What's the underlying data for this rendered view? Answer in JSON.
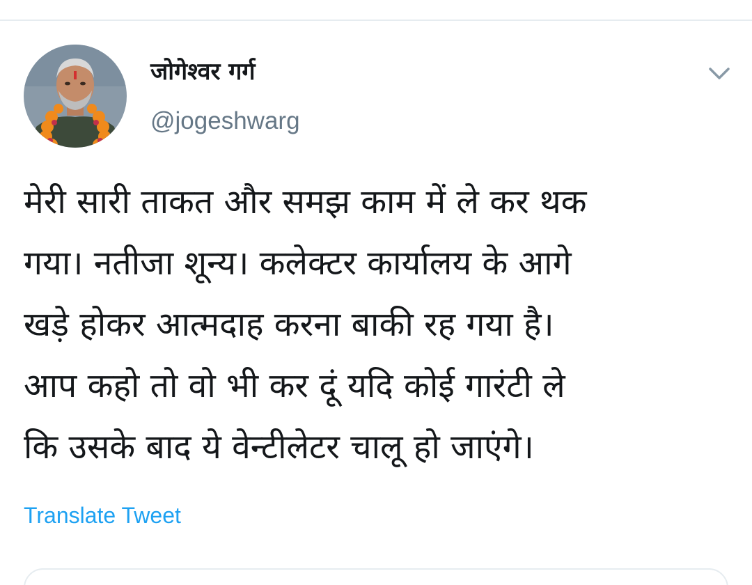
{
  "tweet": {
    "author": {
      "display_name": "जोगेश्वर गर्ग",
      "handle": "@jogeshwarg",
      "avatar_icon": "profile-photo"
    },
    "text": "मेरी सारी ताकत और समझ काम में ले कर थक\nगया। नतीजा शून्य। कलेक्टर कार्यालय के आगे\nखड़े होकर आत्मदाह करना बाकी रह गया है।\nआप कहो तो वो भी कर दूं यदि कोई गारंटी ले\nकि उसके बाद ये वेन्टीलेटर चालू हो जाएंगे।",
    "translate_label": "Translate Tweet",
    "menu_icon": "chevron-down-icon"
  },
  "colors": {
    "text_primary": "#14171a",
    "text_secondary": "#657786",
    "link": "#1da1f2",
    "divider": "#e6ecf0"
  }
}
